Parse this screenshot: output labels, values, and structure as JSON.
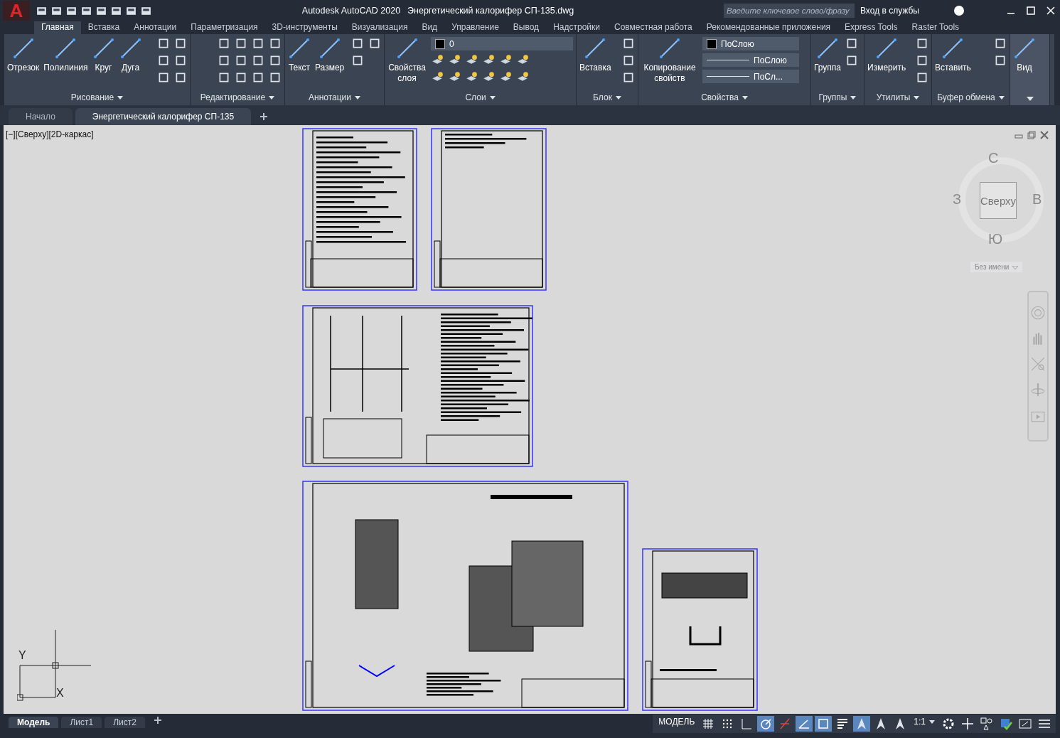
{
  "app": {
    "logo_letter": "A",
    "title": "Autodesk AutoCAD 2020",
    "file": "Энергетический калорифер СП-135.dwg",
    "search": {
      "placeholder": "Введите ключевое слово/фразу"
    },
    "signin": "Вход в службы"
  },
  "ribbon_tabs": [
    {
      "label": "Главная",
      "selected": true
    },
    {
      "label": "Вставка",
      "selected": false
    },
    {
      "label": "Аннотации",
      "selected": false
    },
    {
      "label": "Параметризация",
      "selected": false
    },
    {
      "label": "3D-инструменты",
      "selected": false
    },
    {
      "label": "Визуализация",
      "selected": false
    },
    {
      "label": "Вид",
      "selected": false
    },
    {
      "label": "Управление",
      "selected": false
    },
    {
      "label": "Вывод",
      "selected": false
    },
    {
      "label": "Надстройки",
      "selected": false
    },
    {
      "label": "Совместная работа",
      "selected": false
    },
    {
      "label": "Рекомендованные приложения",
      "selected": false
    },
    {
      "label": "Express Tools",
      "selected": false
    },
    {
      "label": "Raster Tools",
      "selected": false
    }
  ],
  "panels": [
    {
      "kind": "tools",
      "title": "Рисование",
      "tools": [
        "Отрезок",
        "Полилиния",
        "Круг",
        "Дуга"
      ]
    },
    {
      "kind": "tools",
      "title": "Редактирование"
    },
    {
      "kind": "tools",
      "title": "Аннотации",
      "tools": [
        "Текст",
        "Размер"
      ]
    },
    {
      "kind": "layers",
      "title": "Слои",
      "tools": [
        "Свойства слоя"
      ],
      "layer": "0"
    },
    {
      "kind": "tools",
      "title": "Блок",
      "tools": [
        "Вставка"
      ]
    },
    {
      "kind": "properties",
      "title": "Свойства",
      "tools": [
        "Копирование свойств"
      ],
      "values": [
        "ПоСлою",
        "ПоСлою",
        "ПоСл..."
      ]
    },
    {
      "kind": "tools",
      "title": "Группы",
      "tools": [
        "Группа"
      ]
    },
    {
      "kind": "tools",
      "title": "Утилиты",
      "tools": [
        "Измерить"
      ]
    },
    {
      "kind": "tools",
      "title": "Буфер обмена",
      "tools": [
        "Вставить"
      ]
    },
    {
      "kind": "view",
      "tools": [
        "Вид"
      ]
    }
  ],
  "doc_tabs": [
    {
      "label": "Начало",
      "selected": false
    },
    {
      "label": "Энергетический калорифер СП-135",
      "selected": true
    }
  ],
  "viewport": {
    "label": "[−][Сверху][2D-каркас]",
    "viewcube": {
      "face": "Сверху",
      "north": "С",
      "east": "В",
      "south": "Ю",
      "west": "З",
      "ucs": "Без имени"
    },
    "axis_y": "Y",
    "axis_x": "X",
    "sheets": [
      {
        "kind": "text"
      },
      {
        "kind": "blank"
      },
      {
        "kind": "scheme"
      },
      {
        "kind": "assembly"
      },
      {
        "kind": "detail"
      }
    ]
  },
  "layout_tabs": [
    {
      "label": "Модель",
      "selected": true
    },
    {
      "label": "Лист1",
      "selected": false
    },
    {
      "label": "Лист2",
      "selected": false
    }
  ],
  "status": {
    "model": "МОДЕЛЬ",
    "scale": "1:1",
    "toggles": [
      {
        "kind": "grid",
        "on": false
      },
      {
        "kind": "snap",
        "on": false
      },
      {
        "kind": "ortho",
        "on": false
      },
      {
        "kind": "polar",
        "on": true
      },
      {
        "kind": "iso",
        "on": false
      },
      {
        "kind": "angle",
        "on": true
      },
      {
        "kind": "osnap",
        "on": true
      },
      {
        "kind": "lineweight",
        "on": false
      },
      {
        "kind": "annovis",
        "on": true
      },
      {
        "kind": "autoscale",
        "on": false
      },
      {
        "kind": "annoscale",
        "on": false
      }
    ]
  }
}
